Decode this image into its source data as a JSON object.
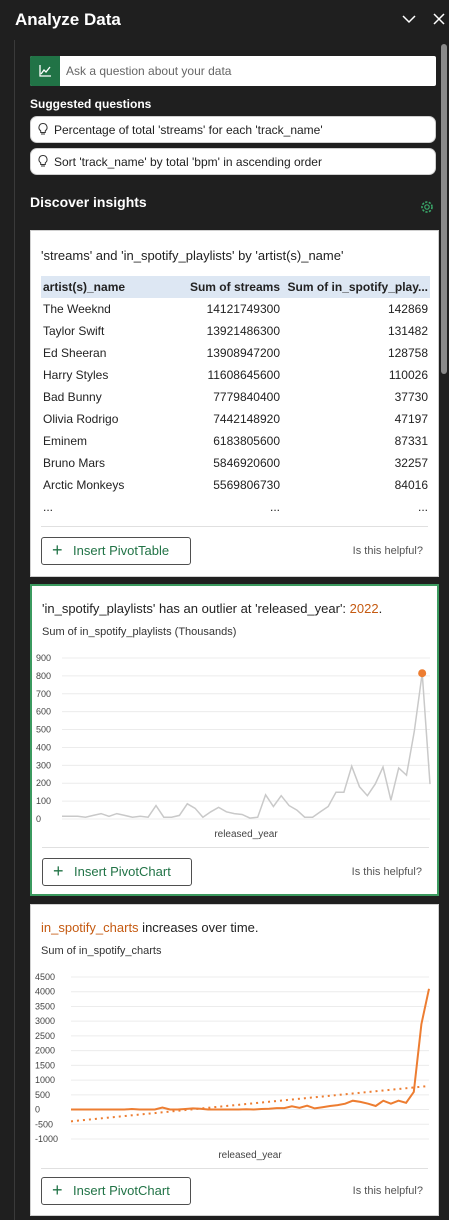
{
  "header": {
    "title": "Analyze Data",
    "collapse_icon": "chevron-down-icon",
    "close_icon": "close-icon"
  },
  "ask": {
    "placeholder": "Ask a question about your data",
    "icon": "chart-icon"
  },
  "suggested": {
    "title": "Suggested questions",
    "items": [
      {
        "text": "Percentage of total 'streams' for each 'track_name'"
      },
      {
        "text": "Sort 'track_name' by total 'bpm' in ascending order"
      }
    ]
  },
  "discover": {
    "title": "Discover insights",
    "settings_icon": "gear-icon"
  },
  "cards": [
    {
      "title": "'streams' and 'in_spotify_playlists' by 'artist(s)_name'",
      "table": {
        "headers": [
          "artist(s)_name",
          "Sum of streams",
          "Sum of in_spotify_play..."
        ],
        "rows": [
          [
            "The Weeknd",
            "14121749300",
            "142869"
          ],
          [
            "Taylor Swift",
            "13921486300",
            "131482"
          ],
          [
            "Ed Sheeran",
            "13908947200",
            "128758"
          ],
          [
            "Harry Styles",
            "11608645600",
            "110026"
          ],
          [
            "Bad Bunny",
            "7779840400",
            "37730"
          ],
          [
            "Olivia Rodrigo",
            "7442148920",
            "47197"
          ],
          [
            "Eminem",
            "6183805600",
            "87331"
          ],
          [
            "Bruno Mars",
            "5846920600",
            "32257"
          ],
          [
            "Arctic Monkeys",
            "5569806730",
            "84016"
          ]
        ],
        "ellipsis": [
          "...",
          "...",
          "..."
        ]
      },
      "button": "Insert PivotTable",
      "helpful": "Is this helpful?"
    },
    {
      "title_pre": "'in_spotify_playlists' has an outlier at 'released_year': ",
      "title_hl": "2022",
      "title_post": ".",
      "subtitle": "Sum of in_spotify_playlists (Thousands)",
      "button": "Insert PivotChart",
      "helpful": "Is this helpful?"
    },
    {
      "title_hl": "in_spotify_charts",
      "title_post": " increases over time.",
      "subtitle": "Sum of in_spotify_charts",
      "button": "Insert PivotChart",
      "helpful": "Is this helpful?"
    }
  ],
  "chart_data": [
    {
      "type": "line",
      "title": "'in_spotify_playlists' has an outlier at 'released_year': 2022.",
      "ylabel": "Sum of in_spotify_playlists (Thousands)",
      "xlabel": "released_year",
      "yticks": [
        0,
        100,
        200,
        300,
        400,
        500,
        600,
        700,
        800,
        900
      ],
      "ylim": [
        0,
        900
      ],
      "line_color": "#c9c9c9",
      "marker_color": "#ed7d31",
      "values": [
        15,
        15,
        15,
        10,
        20,
        30,
        15,
        30,
        20,
        10,
        15,
        10,
        75,
        10,
        10,
        20,
        85,
        60,
        10,
        40,
        65,
        40,
        30,
        25,
        5,
        10,
        135,
        70,
        130,
        75,
        50,
        10,
        10,
        40,
        70,
        150,
        150,
        295,
        180,
        130,
        195,
        290,
        105,
        285,
        245,
        490,
        815,
        195
      ],
      "outlier_index": 46
    },
    {
      "type": "line",
      "title": "in_spotify_charts increases over time.",
      "ylabel": "Sum of in_spotify_charts",
      "xlabel": "released_year",
      "yticks": [
        -1000,
        -500,
        0,
        500,
        1000,
        1500,
        2000,
        2500,
        3000,
        3500,
        4000,
        4500
      ],
      "ylim": [
        -1000,
        4500
      ],
      "line_color": "#ed7d31",
      "trend": [
        -400,
        800
      ],
      "values": [
        0,
        0,
        0,
        0,
        0,
        0,
        0,
        0,
        20,
        0,
        0,
        0,
        70,
        0,
        0,
        20,
        40,
        30,
        0,
        0,
        0,
        0,
        0,
        10,
        0,
        20,
        30,
        50,
        50,
        110,
        60,
        130,
        40,
        80,
        120,
        150,
        200,
        300,
        260,
        200,
        120,
        300,
        200,
        300,
        230,
        600,
        2900,
        4100
      ]
    }
  ]
}
